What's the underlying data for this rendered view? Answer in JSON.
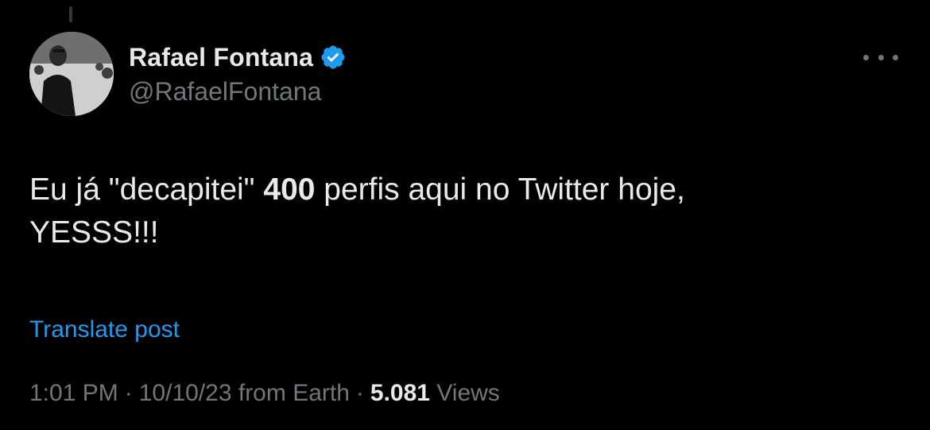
{
  "post": {
    "author": {
      "display_name": "Rafael Fontana",
      "handle": "@RafaelFontana",
      "verified": true,
      "avatar": "profile-photo"
    },
    "more_icon": "more-horizontal-icon",
    "text": {
      "part1": "Eu já \"decapitei\" ",
      "bold": "400",
      "part2": " perfis aqui no Twitter hoje,",
      "line2": "YESSS!!!"
    },
    "translate_label": "Translate post",
    "meta": {
      "time": "1:01 PM",
      "date": "10/10/23",
      "source": "from Earth",
      "separator": "·",
      "views_count": "5.081",
      "views_label": "Views"
    }
  },
  "colors": {
    "background": "#000000",
    "primary_text": "#e7e9ea",
    "secondary_text": "#71767b",
    "link": "#1d9bf0",
    "verified_badge": "#1d9bf0"
  }
}
